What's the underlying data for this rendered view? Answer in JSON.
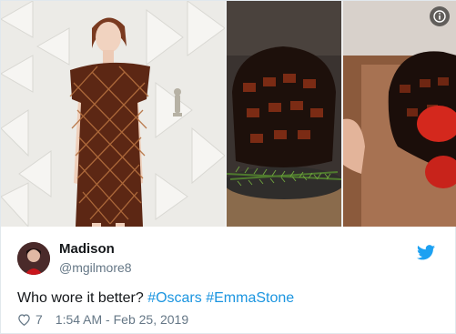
{
  "tweet": {
    "user": {
      "name": "Madison",
      "handle": "@mgilmore8"
    },
    "text_prefix": "Who wore it better?",
    "hashtags": [
      "#Oscars",
      "#EmmaStone"
    ],
    "likes": "7",
    "timestamp": "1:54 AM - Feb 25, 2019"
  },
  "icons": {
    "info": "info-icon",
    "brand": "twitter-bird-icon",
    "like": "heart-icon"
  },
  "colors": {
    "hashtag": "#1b95e0",
    "brand": "#1da1f2",
    "secondary_text": "#657786"
  }
}
